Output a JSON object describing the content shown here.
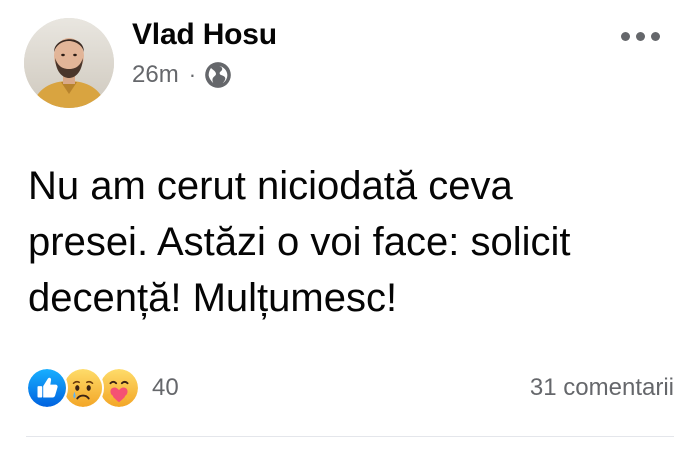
{
  "post": {
    "author": "Vlad Hosu",
    "time": "26m",
    "separator": "·",
    "privacy_icon": "globe-icon",
    "more_icon": "more-options-icon",
    "text_lines": [
      "Nu am cerut niciodată ceva",
      "presei. Astăzi o voi face: solicit",
      "decență! Mulțumesc!"
    ]
  },
  "reactions": {
    "icons": [
      "like-reaction-icon",
      "sad-reaction-icon",
      "care-reaction-icon"
    ],
    "count": "40"
  },
  "comments": {
    "label": "31 comentarii"
  },
  "colors": {
    "secondary_text": "#65676b",
    "like_blue": "#1877f2",
    "divider": "#e4e6eb"
  }
}
